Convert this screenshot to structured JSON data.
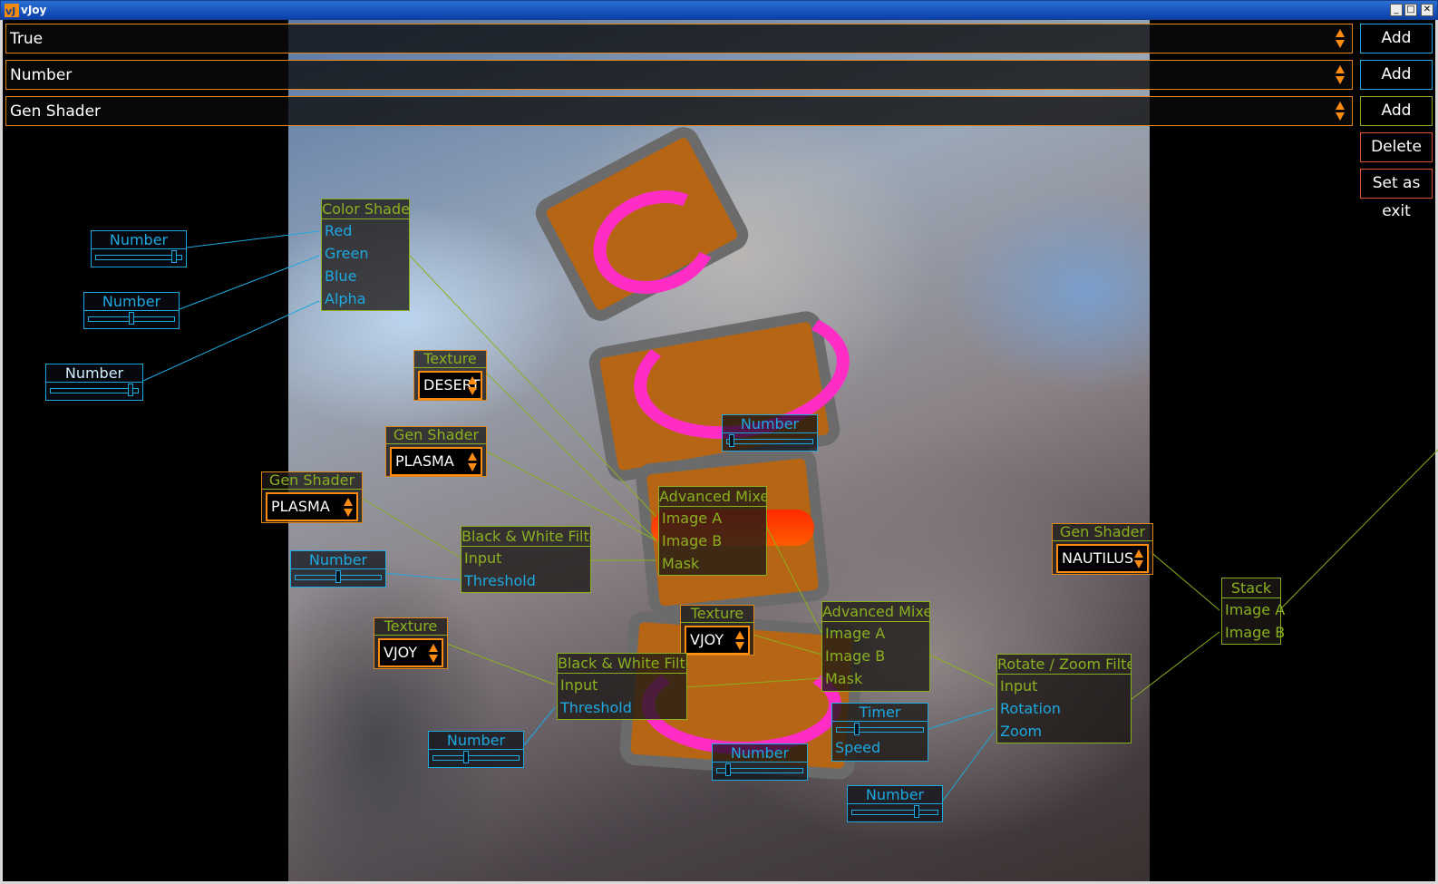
{
  "window": {
    "title": "vJoy",
    "minimize": "_",
    "maximize": "□",
    "close": "✕"
  },
  "toolbar": {
    "combos": [
      {
        "value": "True",
        "add_label": "Add"
      },
      {
        "value": "Number",
        "add_label": "Add"
      },
      {
        "value": "Gen Shader",
        "add_label": "Add"
      }
    ],
    "delete_label": "Delete",
    "set_exit_label": "Set as exit"
  },
  "colors": {
    "accent": "#ff8c10",
    "node_green": "#8ab020",
    "node_blue": "#1ea8e0",
    "pink": "#ff2cc6"
  },
  "nodes": {
    "number_1": {
      "title": "Number",
      "value": 0.95
    },
    "number_2": {
      "title": "Number",
      "value": 0.5
    },
    "number_3": {
      "title": "Number",
      "value": 0.95
    },
    "color_shader": {
      "title": "Color Shader",
      "ports": [
        "Red",
        "Green",
        "Blue",
        "Alpha"
      ]
    },
    "texture_1": {
      "title": "Texture",
      "value": "DESERT"
    },
    "gen_shader_1": {
      "title": "Gen Shader",
      "value": "PLASMA"
    },
    "gen_shader_2": {
      "title": "Gen Shader",
      "value": "PLASMA"
    },
    "number_4": {
      "title": "Number",
      "value": 0.02
    },
    "bw_filter_1": {
      "title": "Black & White Filter",
      "ports": [
        "Input",
        "Threshold"
      ]
    },
    "number_5": {
      "title": "Number",
      "value": 0.5
    },
    "adv_mixer_1": {
      "title": "Advanced Mixer",
      "ports": [
        "Image A",
        "Image B",
        "Mask"
      ]
    },
    "gen_shader_3": {
      "title": "Gen Shader",
      "value": "NAUTILUS"
    },
    "stack": {
      "title": "Stack",
      "ports": [
        "Image A",
        "Image B"
      ]
    },
    "texture_2": {
      "title": "Texture",
      "value": "VJOY"
    },
    "texture_3": {
      "title": "Texture",
      "value": "VJOY"
    },
    "adv_mixer_2": {
      "title": "Advanced Mixer",
      "ports": [
        "Image A",
        "Image B",
        "Mask"
      ]
    },
    "bw_filter_2": {
      "title": "Black & White Filter",
      "ports": [
        "Input",
        "Threshold"
      ]
    },
    "rotate_zoom": {
      "title": "Rotate / Zoom Filter",
      "ports": [
        "Input",
        "Rotation",
        "Zoom"
      ]
    },
    "timer": {
      "title": "Timer",
      "port": "Speed",
      "value": 0.2
    },
    "number_6": {
      "title": "Number",
      "value": 0.35
    },
    "number_7": {
      "title": "Number",
      "value": 0.1
    },
    "number_8": {
      "title": "Number",
      "value": 0.72
    }
  }
}
